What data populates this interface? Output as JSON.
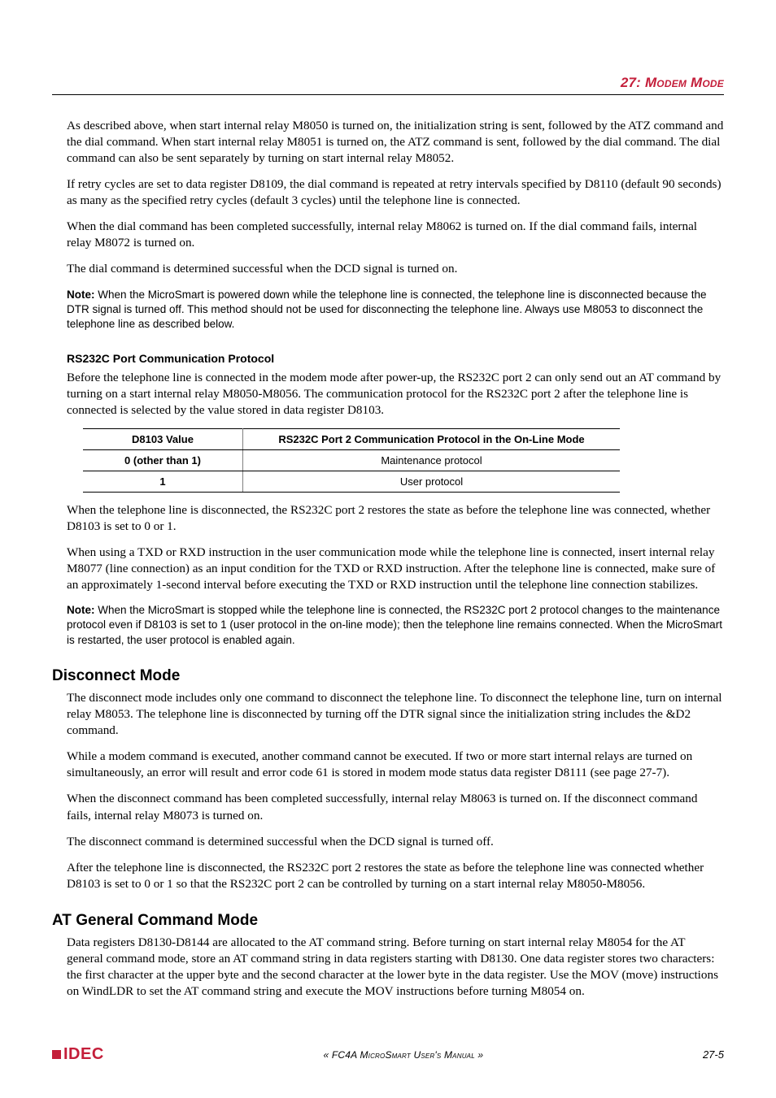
{
  "chapter": {
    "number": "27:",
    "title": "Modem Mode"
  },
  "paragraphs": {
    "p1": "As described above, when start internal relay M8050 is turned on, the initialization string is sent, followed by the ATZ command and the dial command. When start internal relay M8051 is turned on, the ATZ command is sent, followed by the dial command. The dial command can also be sent separately by turning on start internal relay M8052.",
    "p2": "If retry cycles are set to data register D8109, the dial command is repeated at retry intervals specified by D8110 (default 90 seconds) as many as the specified retry cycles (default 3 cycles) until the telephone line is connected.",
    "p3": "When the dial command has been completed successfully, internal relay M8062 is turned on. If the dial command fails, internal relay M8072 is turned on.",
    "p4": "The dial command is determined successful when the DCD signal is turned on.",
    "note1_label": "Note:",
    "note1": " When the MicroSmart is powered down while the telephone line is connected, the telephone line is disconnected because the DTR signal is turned off. This method should not be used for disconnecting the telephone line. Always use M8053 to disconnect the telephone line as described below.",
    "subhead1": "RS232C Port Communication Protocol",
    "p5": "Before the telephone line is connected in the modem mode after power-up, the RS232C port 2 can only send out an AT command by turning on a start internal relay M8050-M8056. The communication protocol for the RS232C port 2 after the telephone line is connected is selected by the value stored in data register D8103.",
    "p6": "When the telephone line is disconnected, the RS232C port 2 restores the state as before the telephone line was connected, whether D8103 is set to 0 or 1.",
    "p7": "When using a TXD or RXD instruction in the user communication mode while the telephone line is connected, insert internal relay M8077 (line connection) as an input condition for the TXD or RXD instruction. After the telephone line is connected, make sure of an approximately 1-second interval before executing the TXD or RXD instruction until the telephone line connection stabilizes.",
    "note2_label": "Note:",
    "note2": " When the MicroSmart is stopped while the telephone line is connected, the RS232C port 2 protocol changes to the maintenance protocol even if D8103 is set to 1 (user protocol in the on-line mode); then the telephone line remains connected. When the MicroSmart is restarted, the user protocol is enabled again.",
    "p8": "The disconnect mode includes only one command to disconnect the telephone line. To disconnect the telephone line, turn on internal relay M8053. The telephone line is disconnected by turning off the DTR signal since the initialization string includes the &D2 command.",
    "p9": "While a modem command is executed, another command cannot be executed. If two or more start internal relays are turned on simultaneously, an error will result and error code 61 is stored in modem mode status data register D8111 (see page 27-7).",
    "p10": "When the disconnect command has been completed successfully, internal relay M8063 is turned on. If the disconnect command fails, internal relay M8073 is turned on.",
    "p11": "The disconnect command is determined successful when the DCD signal is turned off.",
    "p12": "After the telephone line is disconnected, the RS232C port 2 restores the state as before the telephone line was connected whether D8103 is set to 0 or 1 so that the RS232C port 2 can be controlled by turning on a start internal relay M8050-M8056.",
    "p13": "Data registers D8130-D8144 are allocated to the AT command string. Before turning on start internal relay M8054 for the AT general command mode, store an AT command string in data registers starting with D8130. One data register stores two characters: the first character at the upper byte and the second character at the lower byte in the data register. Use the MOV (move) instructions on WindLDR to set the AT command string and execute the MOV instructions before turning M8054 on."
  },
  "sections": {
    "disconnect": "Disconnect Mode",
    "atgeneral": "AT General Command Mode"
  },
  "table": {
    "headers": [
      "D8103 Value",
      "RS232C Port 2 Communication Protocol in the On-Line Mode"
    ],
    "rows": [
      {
        "c0": "0 (other than 1)",
        "c1": "Maintenance protocol"
      },
      {
        "c0": "1",
        "c1": "User protocol"
      }
    ]
  },
  "footer": {
    "brand": "IDEC",
    "center": "« FC4A MicroSmart User's Manual »",
    "page": "27-5"
  }
}
